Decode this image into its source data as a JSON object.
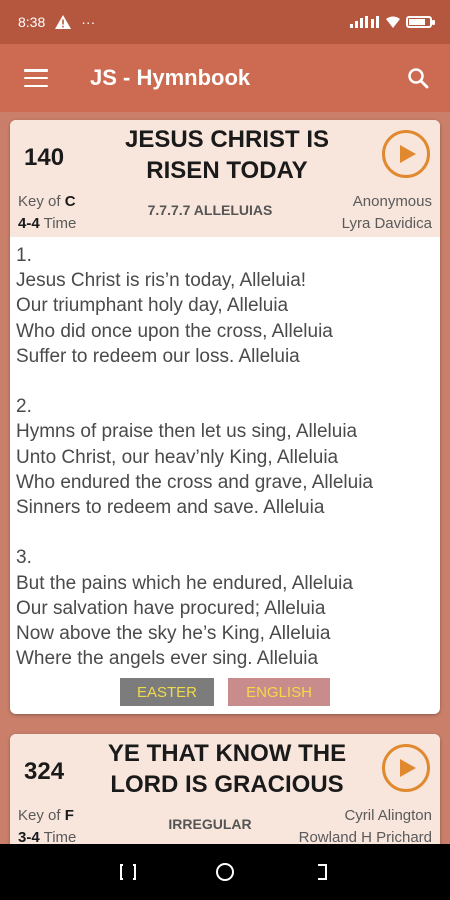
{
  "status_bar": {
    "time": "8:38",
    "dots": "···"
  },
  "app_bar": {
    "title": "JS - Hymnbook",
    "menu_icon": "menu-icon",
    "search_icon": "search-icon"
  },
  "hymns": [
    {
      "number": "140",
      "title": "JESUS CHRIST IS RISEN TODAY",
      "key_label": "Key of",
      "key": "C",
      "time_sig": "4-4",
      "time_label": "Time",
      "meter": "7.7.7.7 ALLELUIAS",
      "author_1": "Anonymous",
      "author_2": "Lyra Davidica",
      "lyrics": "1.\nJesus Christ is ris’n today, Alleluia!\nOur triumphant holy day, Alleluia\nWho did once upon the cross, Alleluia\nSuffer to redeem our loss. Alleluia\n\n2.\nHymns of praise then let us sing, Alleluia\nUnto Christ, our heav’nly King, Alleluia\nWho endured the cross and grave, Alleluia\nSinners to redeem and save. Alleluia\n\n3.\nBut the pains which he endured, Alleluia\nOur salvation have procured; Alleluia\nNow above the sky he’s King, Alleluia\nWhere the angels ever sing. Alleluia",
      "tags": [
        "EASTER",
        "ENGLISH"
      ]
    },
    {
      "number": "324",
      "title": "YE THAT KNOW THE LORD IS GRACIOUS",
      "key_label": "Key of",
      "key": "F",
      "time_sig": "3-4",
      "time_label": "Time",
      "meter": "IRREGULAR",
      "author_1": "Cyril Alington",
      "author_2": "Rowland H Prichard"
    }
  ],
  "colors": {
    "status_bar": "#b5573f",
    "app_bar": "#cc6b52",
    "background": "#c97f69",
    "card_header": "#f8e6dd",
    "play_accent": "#e0892f",
    "tag_text": "#f2d94a"
  }
}
